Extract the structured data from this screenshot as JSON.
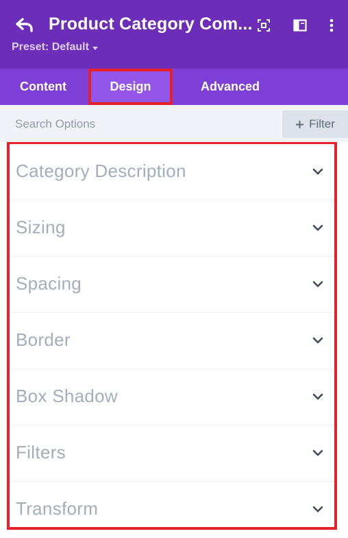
{
  "header": {
    "title": "Product Category Com...",
    "preset_label": "Preset: Default",
    "icons": [
      "back-arrow-icon",
      "focus-icon",
      "split-layout-icon",
      "more-vertical-icon"
    ],
    "background": "#6c2eb9"
  },
  "tabs": [
    {
      "label": "Content",
      "active": false
    },
    {
      "label": "Design",
      "active": true
    },
    {
      "label": "Advanced",
      "active": false
    }
  ],
  "search": {
    "placeholder": "Search Options",
    "value": "",
    "filter_label": "Filter"
  },
  "option_groups": [
    {
      "label": "Category Description"
    },
    {
      "label": "Sizing"
    },
    {
      "label": "Spacing"
    },
    {
      "label": "Border"
    },
    {
      "label": "Box Shadow"
    },
    {
      "label": "Filters"
    },
    {
      "label": "Transform"
    }
  ],
  "colors": {
    "brand_purple": "#6c2eb9",
    "tab_bar": "#7d3fd6",
    "tab_active": "#9356e8",
    "highlight_red": "#e52229",
    "label_gray": "#a3aebd"
  }
}
